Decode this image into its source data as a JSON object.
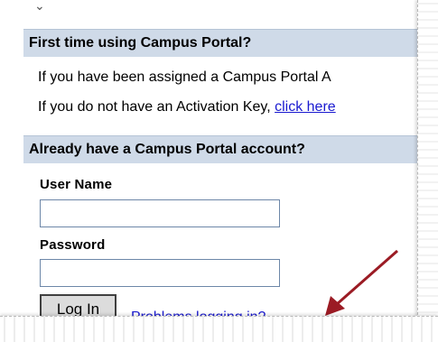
{
  "first_time": {
    "heading": "First time using Campus Portal?",
    "line1": "If you have been assigned a Campus Portal A",
    "line2_text": "If you do not have an Activation Key, ",
    "line2_link": "click here"
  },
  "already": {
    "heading": "Already have a Campus Portal account?"
  },
  "login": {
    "username_label": "User Name",
    "username_value": "",
    "password_label": "Password",
    "password_value": "",
    "login_button": "Log In",
    "problems_link": "Problems logging in?"
  },
  "colors": {
    "header_bg": "#cfdae8",
    "link": "#1a1ad0",
    "arrow": "#9b1b24"
  },
  "icons": {
    "annotation": "arrow-icon"
  }
}
